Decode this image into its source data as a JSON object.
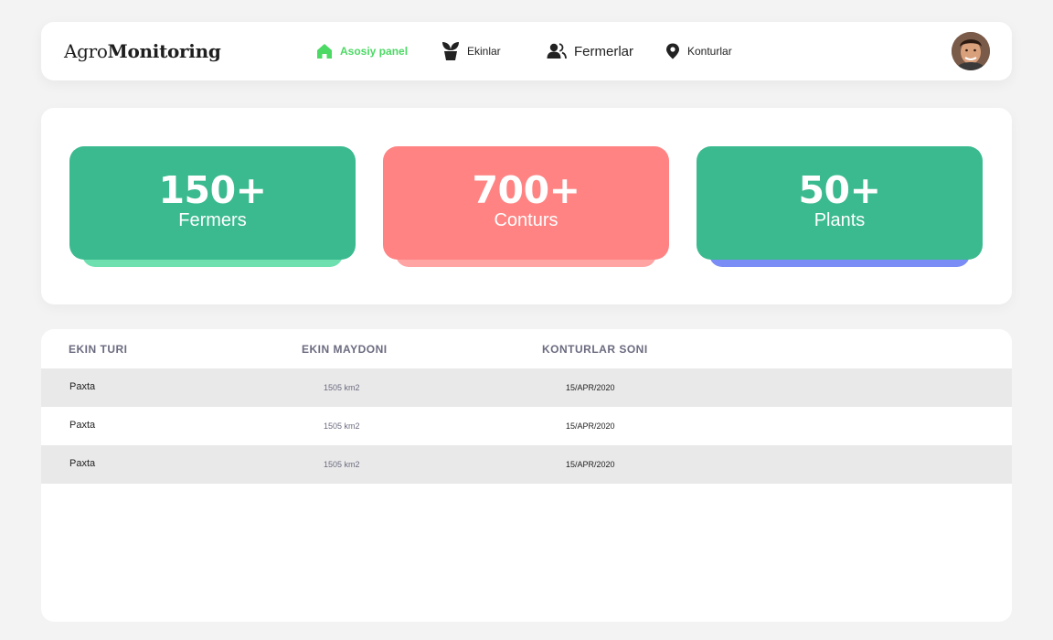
{
  "header": {
    "logo_light": "Agro",
    "logo_bold": "Monitoring",
    "nav": [
      {
        "label": "Asosiy panel",
        "icon": "home-icon",
        "active": true
      },
      {
        "label": "Ekinlar",
        "icon": "plant-icon",
        "active": false
      },
      {
        "label": "Fermerlar",
        "icon": "users-icon",
        "active": false
      },
      {
        "label": "Konturlar",
        "icon": "location-pin-icon",
        "active": false
      }
    ],
    "avatar": "user-avatar"
  },
  "stats": [
    {
      "value": "150+",
      "label": "Fermers",
      "color": "#3bba8f",
      "under_color": "#6ee0b0"
    },
    {
      "value": "700+",
      "label": "Conturs",
      "color": "#ff8383",
      "under_color": "#ffa3a3"
    },
    {
      "value": "50+",
      "label": "Plants",
      "color": "#3bba8f",
      "under_color": "#7a8cf5"
    }
  ],
  "table": {
    "columns": [
      "EKIN TURI",
      "EKIN MAYDONI",
      "KONTURLAR SONI"
    ],
    "rows": [
      [
        "Paxta",
        "1505 km2",
        "15/APR/2020"
      ],
      [
        "Paxta",
        "1505 km2",
        "15/APR/2020"
      ],
      [
        "Paxta",
        "1505 km2",
        "15/APR/2020"
      ]
    ]
  },
  "colors": {
    "accent": "#4cd964",
    "background": "#f3f3f3",
    "row_shade": "#e9e9e9"
  }
}
